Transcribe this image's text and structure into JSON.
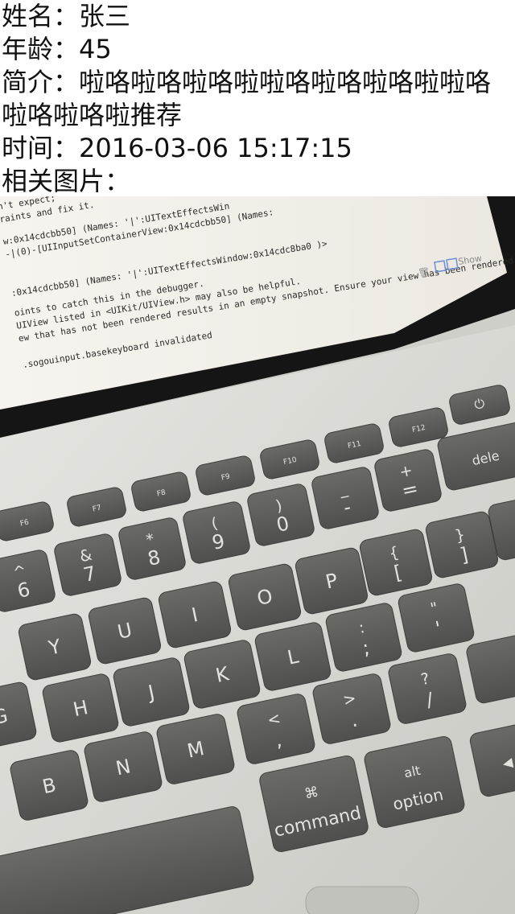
{
  "profile": {
    "name_label": "姓名：",
    "name_value": "张三",
    "age_label": "年龄：",
    "age_value": "45",
    "intro_label": "简介：",
    "intro_value": "啦咯啦咯啦咯啦啦咯啦咯啦咯啦啦咯啦咯啦咯啦推荐",
    "time_label": "时间：",
    "time_value": "2016-03-06 15:17:15",
    "images_label": "相关图片："
  },
  "photo": {
    "screen_lines": [
      "n't expect;",
      "raints and fix it.",
      "w:0x14cdcbb50]    (Names: '|':UITextEffectsWin",
      "-|(0)-[UIInputSetContainerView:0x14cdcbb50]   (Names:",
      ":0x14cdcbb50]   (Names: '|':UITextEffectsWindow:0x14cdc8ba0 )>",
      "oints to catch this in the debugger.",
      " UIView listed in <UIKit/UIView.h> may also be helpful.",
      "ew that has not been rendered results in an empty snapshot. Ensure your view has been rendered at least once",
      ".sogouinput.basekeyboard invalidated"
    ],
    "keys": {
      "f6": "F6",
      "f7": "F7",
      "f8": "F8",
      "f9": "F9",
      "f10": "F10",
      "f11": "F11",
      "f12": "F12",
      "six": "6",
      "six_sym": "^",
      "seven": "7",
      "seven_sym": "&",
      "eight": "8",
      "eight_sym": "*",
      "nine": "9",
      "nine_sym": "(",
      "zero": "0",
      "zero_sym": ")",
      "minus": "-",
      "minus_sym": "_",
      "equal": "=",
      "equal_sym": "+",
      "y": "Y",
      "u": "U",
      "i": "I",
      "o": "O",
      "p": "P",
      "lbracket": "[",
      "lbracket_sym": "{",
      "rbracket": "]",
      "rbracket_sym": "}",
      "h": "H",
      "j": "J",
      "k": "K",
      "l": "L",
      "semicolon": ";",
      "semicolon_sym": ":",
      "quote": "'",
      "quote_sym": "\"",
      "b": "B",
      "n": "N",
      "m": "M",
      "comma": ",",
      "comma_sym": "<",
      "period": ".",
      "period_sym": ">",
      "slash": "/",
      "slash_sym": "?",
      "command_symbol": "⌘",
      "command": "command",
      "alt": "alt",
      "option": "option",
      "delete_partial": "dele",
      "show_partial": "Show"
    },
    "colors": {
      "screen_bg": "#f4f1ec",
      "bezel": "#1a1a1a",
      "keyboard_body": "#d8d8d4",
      "key": "#5d5e5b",
      "key_label": "#e4e4df"
    }
  }
}
